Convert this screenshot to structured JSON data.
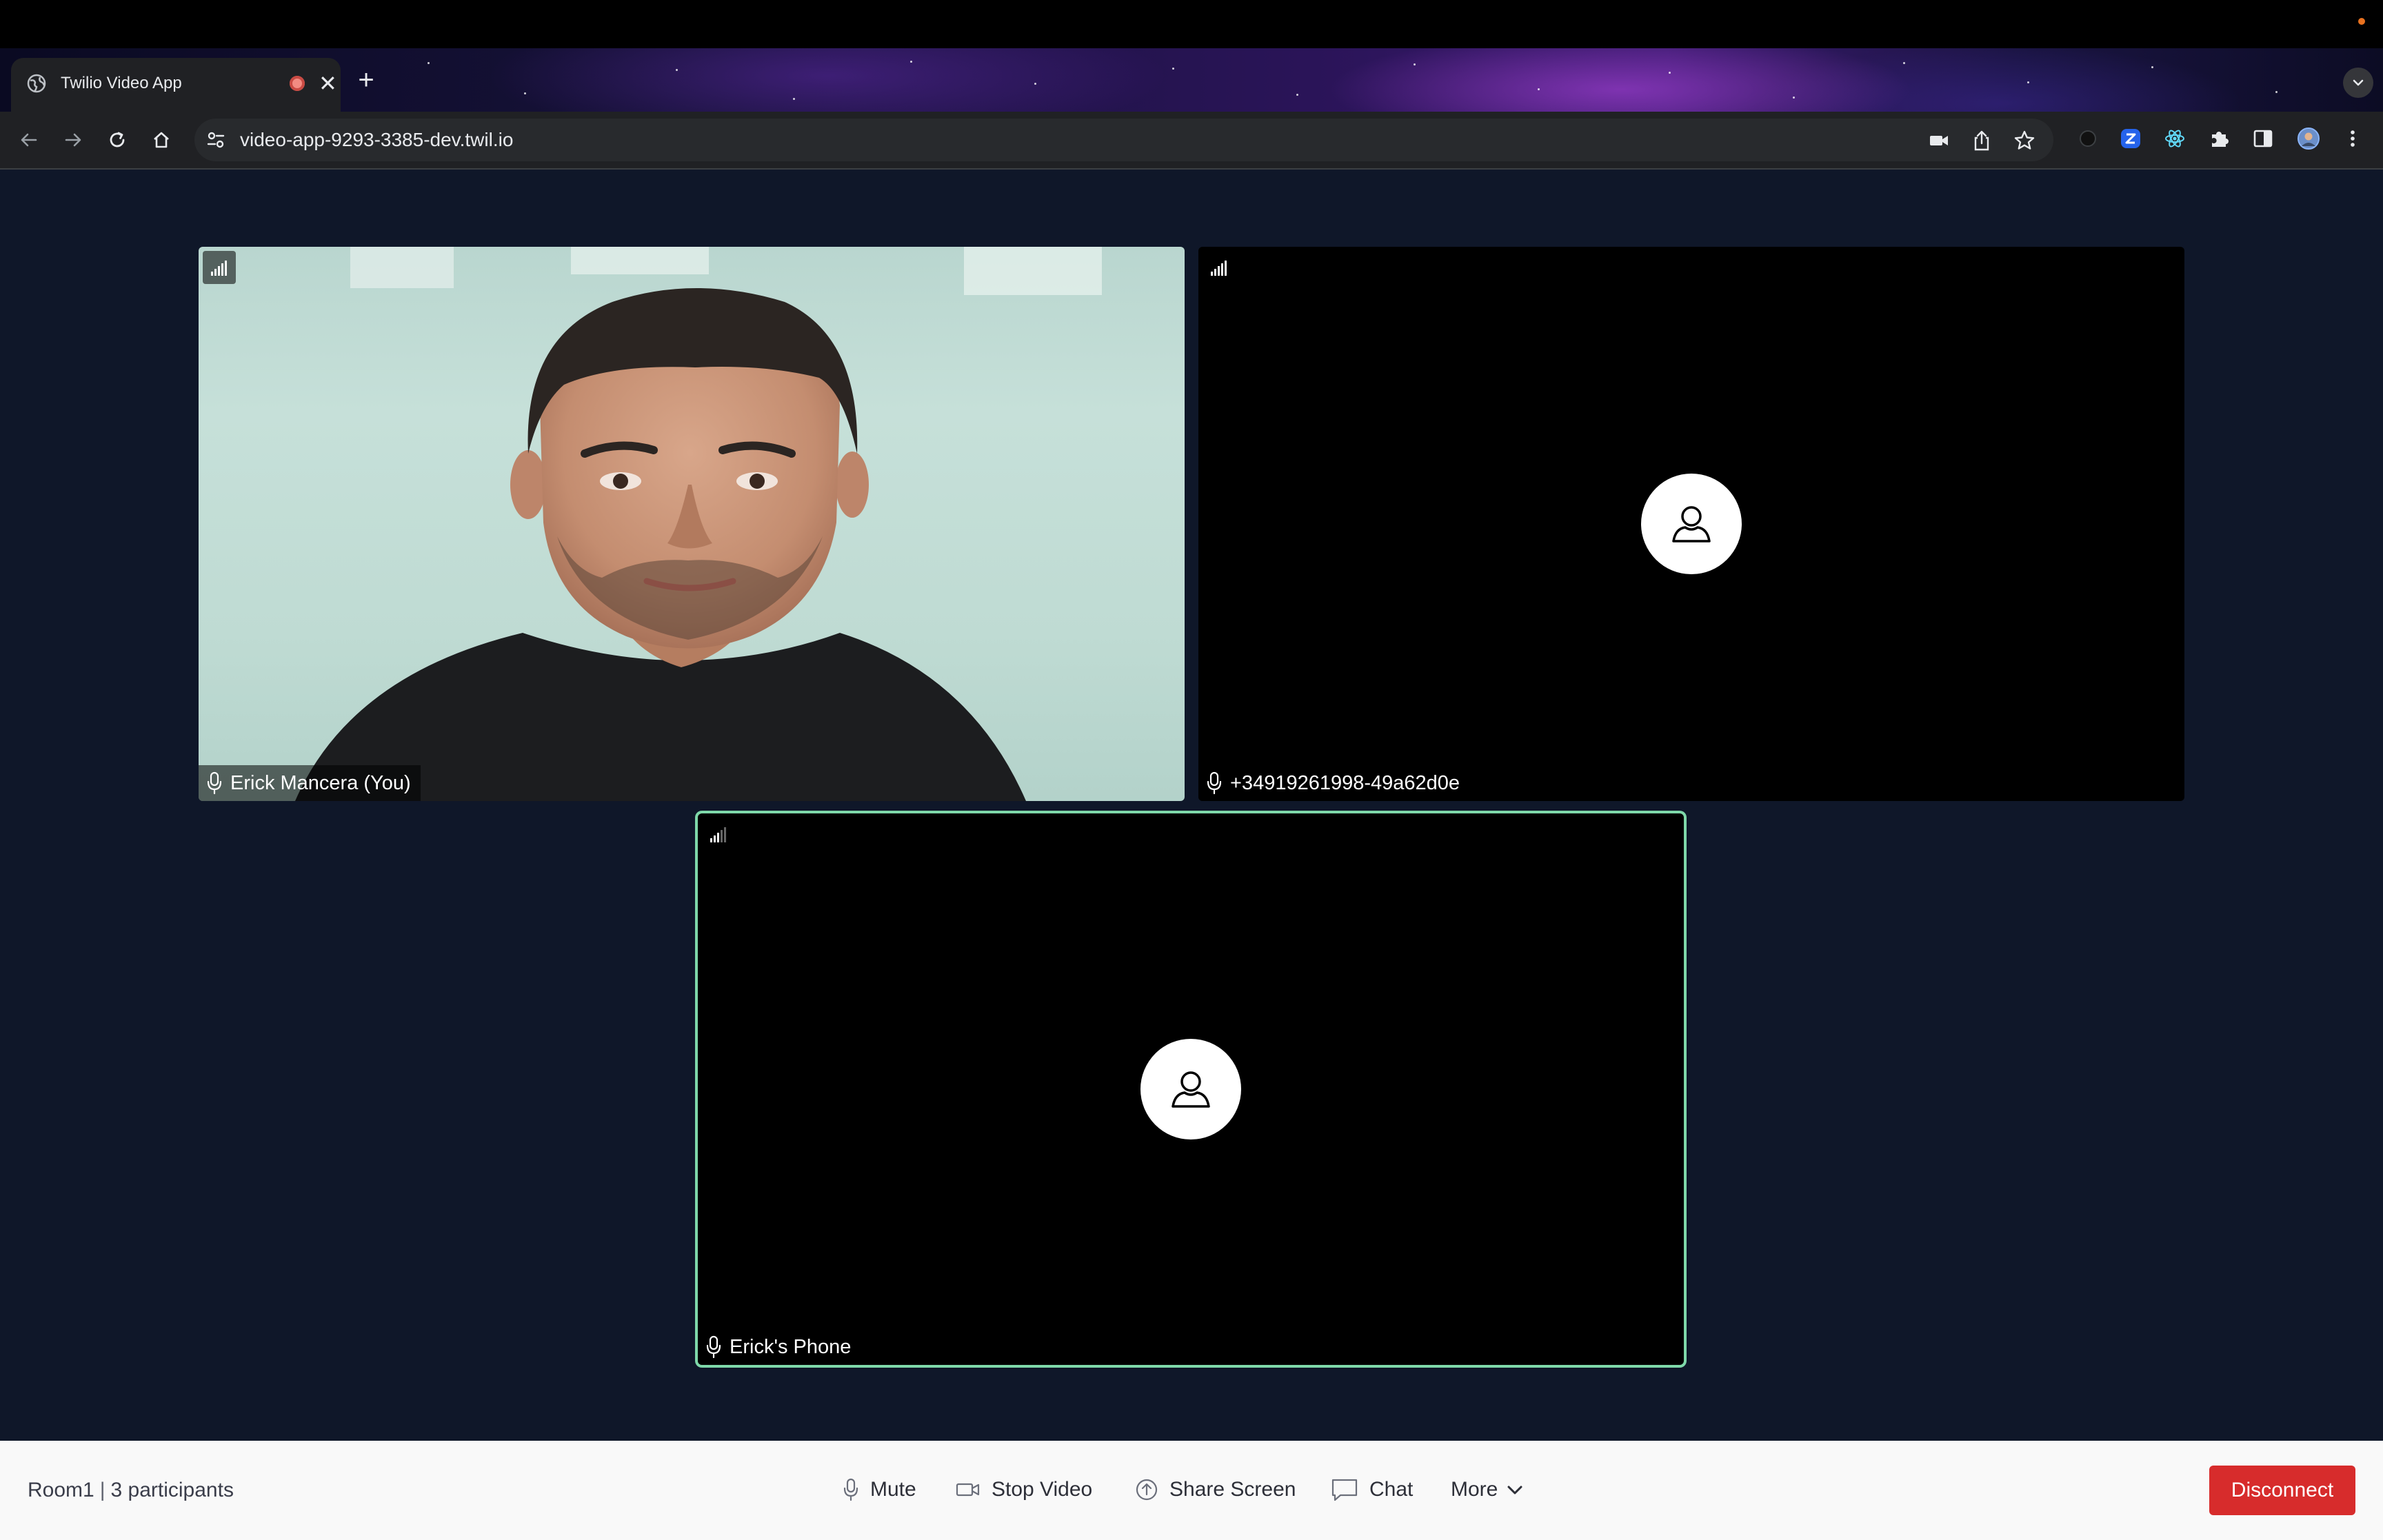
{
  "browser": {
    "tab": {
      "title": "Twilio Video App",
      "close_glyph": "✕"
    },
    "new_tab_glyph": "+",
    "address_bar": {
      "url": "video-app-9293-3385-dev.twil.io"
    },
    "extensions": [
      "camera-icon",
      "share-icon",
      "bookmark-star-icon",
      "extension-z-icon",
      "react-devtools-icon",
      "puzzle-extensions-icon",
      "side-panel-icon",
      "profile-avatar",
      "more-menu-icon"
    ]
  },
  "participants": [
    {
      "name": "Erick Mancera (You)",
      "video": "on",
      "signal_bars": 5
    },
    {
      "name": "+34919261998-49a62d0e",
      "video": "off",
      "signal_bars": 5
    },
    {
      "name": "Erick's Phone",
      "video": "off",
      "signal_bars": 3,
      "dominant_speaker": true
    }
  ],
  "footer": {
    "room_name": "Room1",
    "separator": "|",
    "participant_count": "3 participants",
    "buttons": {
      "mute": "Mute",
      "stop_video": "Stop Video",
      "share_screen": "Share Screen",
      "chat": "Chat",
      "more": "More",
      "disconnect": "Disconnect"
    }
  },
  "colors": {
    "background": "#0f1729",
    "dominant_speaker_border": "#7ed8a9",
    "disconnect": "#d72c2c",
    "footer": "#f9f9f9"
  }
}
